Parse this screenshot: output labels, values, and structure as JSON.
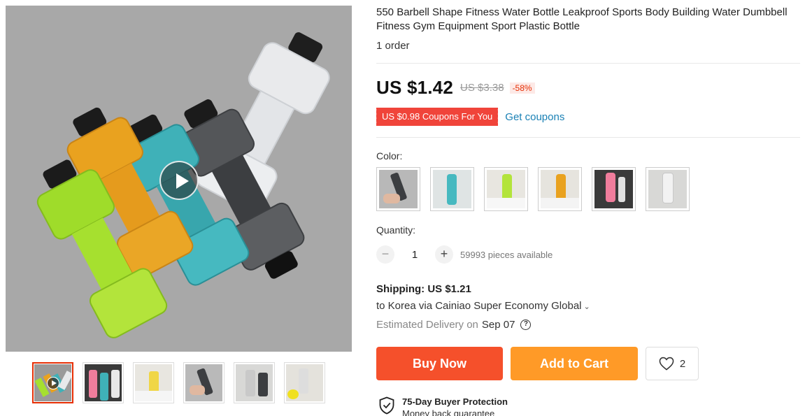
{
  "product": {
    "title": "550 Barbell Shape Fitness Water Bottle Leakproof Sports Body Building Water Dumbbell Fitness Gym Equipment Sport Plastic Bottle",
    "orders": "1 order"
  },
  "price": {
    "current": "US $1.42",
    "original": "US $3.38",
    "discount": "-58%"
  },
  "coupon": {
    "badge": "US $0.98 Coupons For You",
    "link": "Get coupons"
  },
  "color": {
    "label": "Color:",
    "options": [
      "black",
      "cyan",
      "yellow",
      "orange",
      "pink",
      "white"
    ]
  },
  "quantity": {
    "label": "Quantity:",
    "minus": "−",
    "value": "1",
    "plus": "+",
    "available": "59993 pieces available"
  },
  "shipping": {
    "title": "Shipping: US $1.21",
    "destination": "to Korea via Cainiao Super Economy Global",
    "eta_label": "Estimated Delivery on",
    "eta_date": "Sep 07",
    "help": "?"
  },
  "actions": {
    "buy_now": "Buy Now",
    "add_to_cart": "Add to Cart",
    "wishlist_count": "2"
  },
  "protection": {
    "title": "75-Day Buyer Protection",
    "subtitle": "Money back guarantee"
  },
  "icons": {
    "play": "play-icon",
    "heart": "heart-icon",
    "shield": "shield-check-icon",
    "help": "question-circle-icon",
    "chevron": "chevron-down-icon"
  },
  "colors": {
    "accent": "#e62e04",
    "buy_now": "#f5502b",
    "add_to_cart": "#ff9a27",
    "link": "#1a81b5",
    "coupon": "#f0443a"
  }
}
